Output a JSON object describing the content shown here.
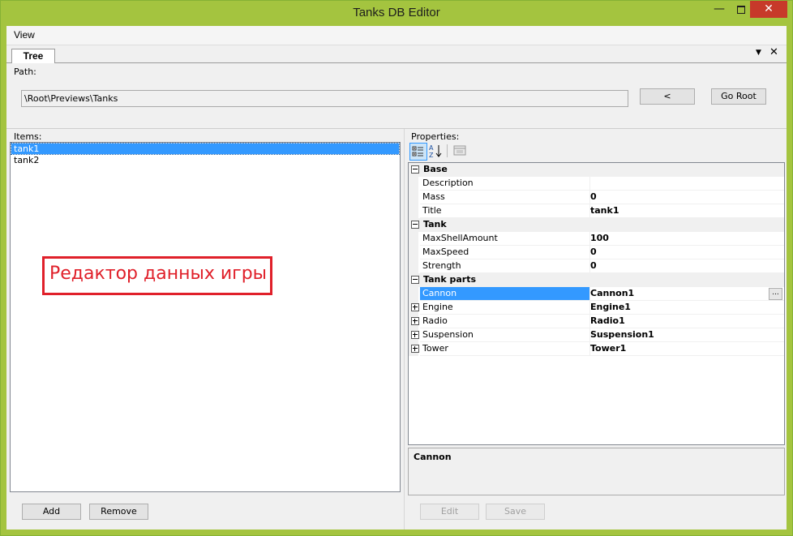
{
  "window": {
    "title": "Tanks DB Editor"
  },
  "menu": {
    "view": "View"
  },
  "tab": {
    "label": "Tree"
  },
  "path": {
    "label": "Path:",
    "value": "\\Root\\Previews\\Tanks",
    "back_label": "<",
    "go_root_label": "Go Root"
  },
  "items": {
    "label": "Items:",
    "list": [
      "tank1",
      "tank2"
    ],
    "selected_index": 0,
    "add_label": "Add",
    "remove_label": "Remove"
  },
  "properties": {
    "label": "Properties:",
    "categories": [
      {
        "name": "Base",
        "rows": [
          {
            "name": "Description",
            "value": ""
          },
          {
            "name": "Mass",
            "value": "0"
          },
          {
            "name": "Title",
            "value": "tank1"
          }
        ]
      },
      {
        "name": "Tank",
        "rows": [
          {
            "name": "MaxShellAmount",
            "value": "100"
          },
          {
            "name": "MaxSpeed",
            "value": "0"
          },
          {
            "name": "Strength",
            "value": "0"
          }
        ]
      },
      {
        "name": "Tank parts",
        "rows": [
          {
            "name": "Cannon",
            "value": "Cannon1",
            "selected": true,
            "ellipsis": "..."
          },
          {
            "name": "Engine",
            "value": "Engine1",
            "expandable": true
          },
          {
            "name": "Radio",
            "value": "Radio1",
            "expandable": true
          },
          {
            "name": "Suspension",
            "value": "Suspension1",
            "expandable": true
          },
          {
            "name": "Tower",
            "value": "Tower1",
            "expandable": true
          }
        ]
      }
    ],
    "description_title": "Cannon",
    "edit_label": "Edit",
    "save_label": "Save"
  },
  "annotation": {
    "text": "Редактор данных игры",
    "color": "#e0202a"
  },
  "colors": {
    "titlebar": "#a4c43f",
    "close": "#c7392a",
    "selection": "#3399ff"
  }
}
